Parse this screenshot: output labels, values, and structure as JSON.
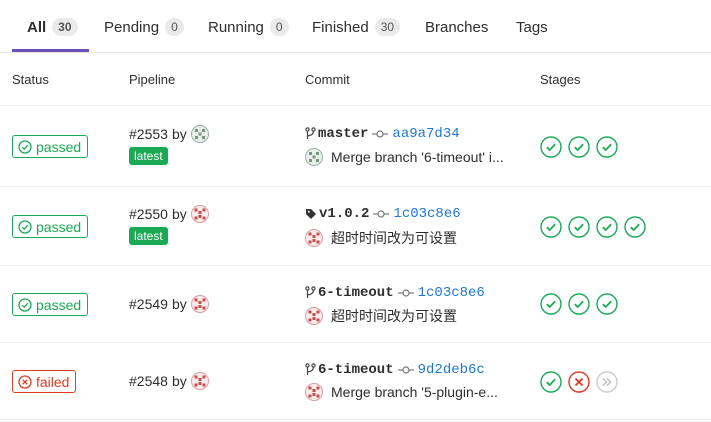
{
  "tabs": [
    {
      "label": "All",
      "count": "30"
    },
    {
      "label": "Pending",
      "count": "0"
    },
    {
      "label": "Running",
      "count": "0"
    },
    {
      "label": "Finished",
      "count": "30"
    },
    {
      "label": "Branches"
    },
    {
      "label": "Tags"
    }
  ],
  "headers": {
    "status": "Status",
    "pipeline": "Pipeline",
    "commit": "Commit",
    "stages": "Stages"
  },
  "colors": {
    "success": "#1aaa55",
    "failed": "#db3b21",
    "link": "#1f78d1",
    "accent": "#6b4fbb",
    "skipped": "#cccccc"
  },
  "rows": [
    {
      "status": "passed",
      "pipeline": "#2553",
      "by": "by",
      "latest": "latest",
      "ref": "master",
      "ref_icon": "branch-icon",
      "sha": "aa9a7d34",
      "message": "Merge branch '6-timeout' i...",
      "stages": [
        "success",
        "success",
        "success"
      ]
    },
    {
      "status": "passed",
      "pipeline": "#2550",
      "by": "by",
      "latest": "latest",
      "ref": "v1.0.2",
      "ref_icon": "tag-icon",
      "sha": "1c03c8e6",
      "message": "超时时间改为可设置",
      "stages": [
        "success",
        "success",
        "success",
        "success"
      ]
    },
    {
      "status": "passed",
      "pipeline": "#2549",
      "by": "by",
      "ref": "6-timeout",
      "ref_icon": "branch-icon",
      "sha": "1c03c8e6",
      "message": "超时时间改为可设置",
      "stages": [
        "success",
        "success",
        "success"
      ]
    },
    {
      "status": "failed",
      "pipeline": "#2548",
      "by": "by",
      "ref": "6-timeout",
      "ref_icon": "branch-icon",
      "sha": "9d2deb6c",
      "message": "Merge branch '5-plugin-e...",
      "stages": [
        "success",
        "failed",
        "skipped"
      ]
    }
  ]
}
